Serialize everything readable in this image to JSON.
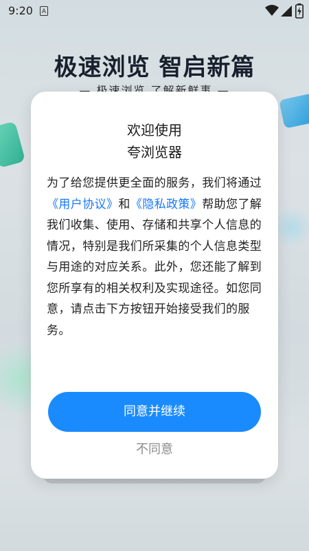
{
  "status": {
    "time": "9:20",
    "sim_label": "A"
  },
  "background": {
    "title": "极速浏览 智启新篇",
    "subtitle": "— 极速浏览 了解新鲜事 —"
  },
  "dialog": {
    "title_line1": "欢迎使用",
    "title_line2": "夸浏览器",
    "body": {
      "part1": "为了给您提供更全面的服务，我们将通过",
      "link_user": "《用户协议》",
      "part2": "和",
      "link_privacy": "《隐私政策》",
      "part3": "帮助您了解我们收集、使用、存储和共享个人信息的情况，特别是我们所采集的个人信息类型与用途的对应关系。此外，您还能了解到您所享有的相关权利及实现途径。如您同意，请点击下方按钮开始接受我们的服务。"
    },
    "agree_label": "同意并继续",
    "disagree_label": "不同意"
  },
  "colors": {
    "primary": "#1a8bff",
    "link": "#1677ff"
  }
}
